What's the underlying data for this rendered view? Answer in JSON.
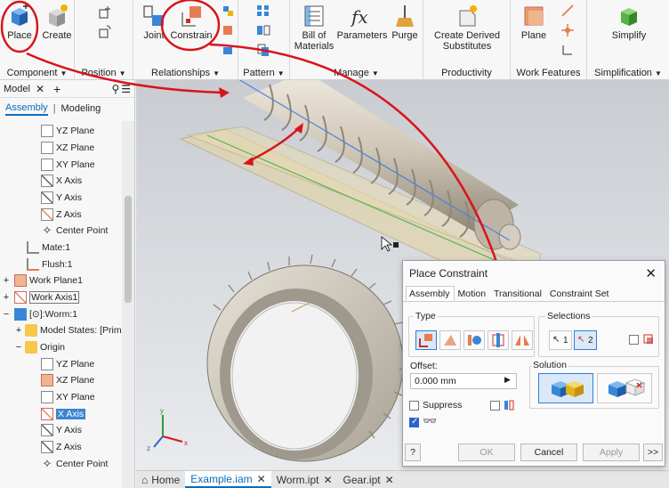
{
  "ribbon": {
    "groups": {
      "component": "Component",
      "position": "Position",
      "relationships": "Relationships",
      "pattern": "Pattern",
      "manage": "Manage",
      "productivity": "Productivity",
      "work_features": "Work Features",
      "simplification": "Simplification"
    },
    "buttons": {
      "place": "Place",
      "create": "Create",
      "joint": "Joint",
      "constrain": "Constrain",
      "bom_line1": "Bill of",
      "bom_line2": "Materials",
      "parameters": "Parameters",
      "purge": "Purge",
      "derived_line1": "Create Derived",
      "derived_line2": "Substitutes",
      "plane": "Plane",
      "simplify": "Simplify"
    }
  },
  "browser": {
    "tab_label": "Model",
    "mode_assembly": "Assembly",
    "mode_modeling": "Modeling",
    "tree": [
      {
        "label": "YZ Plane",
        "icon": "plane-icon"
      },
      {
        "label": "XZ Plane",
        "icon": "plane-icon"
      },
      {
        "label": "XY Plane",
        "icon": "plane-icon"
      },
      {
        "label": "X Axis",
        "icon": "axis-icon"
      },
      {
        "label": "Y Axis",
        "icon": "axis-icon"
      },
      {
        "label": "Z Axis",
        "icon": "axis-icon"
      },
      {
        "label": "Center Point",
        "icon": "point-icon"
      },
      {
        "label": "Mate:1",
        "icon": "mate-icon"
      },
      {
        "label": "Flush:1",
        "icon": "flush-icon"
      },
      {
        "label": "Work Plane1",
        "icon": "workplane-icon"
      },
      {
        "label": "Work Axis1",
        "icon": "workaxis-icon"
      },
      {
        "label": "[⊙]:Worm:1",
        "icon": "part-icon"
      },
      {
        "label": "Model States: [Prim",
        "icon": "folder-icon"
      },
      {
        "label": "Origin",
        "icon": "folder-icon"
      },
      {
        "label": "YZ Plane",
        "icon": "plane-icon"
      },
      {
        "label": "XZ Plane",
        "icon": "plane-icon"
      },
      {
        "label": "XY Plane",
        "icon": "plane-icon"
      },
      {
        "label": "X Axis",
        "icon": "axis-icon"
      },
      {
        "label": "Y Axis",
        "icon": "axis-icon"
      },
      {
        "label": "Z Axis",
        "icon": "axis-icon"
      },
      {
        "label": "Center Point",
        "icon": "point-icon"
      }
    ]
  },
  "doc_tabs": {
    "home": "Home",
    "tabs": [
      "Example.iam",
      "Worm.ipt",
      "Gear.ipt"
    ]
  },
  "dialog": {
    "title": "Place Constraint",
    "tabs": [
      "Assembly",
      "Motion",
      "Transitional",
      "Constraint Set"
    ],
    "type_label": "Type",
    "selections_label": "Selections",
    "sel1": "1",
    "sel2": "2",
    "offset_label": "Offset:",
    "offset_value": "0.000 mm",
    "solution_label": "Solution",
    "suppress_label": "Suppress",
    "ok": "OK",
    "cancel": "Cancel",
    "apply": "Apply",
    "more": ">>"
  },
  "colors": {
    "accent": "#0b6cbd",
    "selection": "#3d84d0",
    "annotation_red": "#d9141b"
  }
}
